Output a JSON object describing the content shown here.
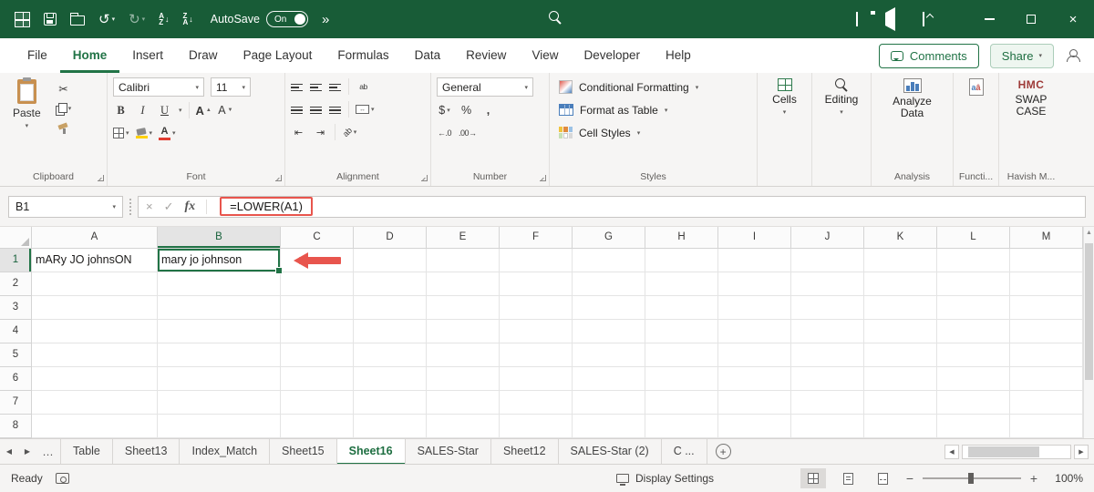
{
  "colors": {
    "accent": "#217346",
    "titlebar": "#185c37",
    "annotation": "#e8554d"
  },
  "titlebar": {
    "autosave_label": "AutoSave",
    "autosave_state": "On"
  },
  "icons": {
    "dropdown": "▾",
    "more": "»",
    "undo": "↺",
    "redo": "↻",
    "sort_a": "A",
    "sort_z": "Z",
    "sort_arrow": "↓",
    "cut": "✂",
    "bold": "B",
    "italic": "I",
    "underline": "U",
    "letter_a": "A",
    "tri_up": "▲",
    "tri_down": "▼",
    "merge_arrows": "↔",
    "wrap_text": "ab",
    "orient_text": "ab",
    "indent_left": "⇤",
    "indent_right": "⇥",
    "dollar": "$",
    "percent": "%",
    "comma": ",",
    "inc_decimal": "←.0",
    "dec_decimal": ".00→",
    "cancel": "×",
    "enter": "✓",
    "fx": "fx",
    "prev": "◀",
    "next": "▶",
    "up": "▲",
    "ellipsis": "…",
    "plus": "+",
    "zoom_out": "−",
    "zoom_in": "+",
    "close": "×"
  },
  "menu": {
    "tabs": [
      "File",
      "Home",
      "Insert",
      "Draw",
      "Page Layout",
      "Formulas",
      "Data",
      "Review",
      "View",
      "Developer",
      "Help"
    ],
    "active_tab": "Home",
    "comments_label": "Comments",
    "share_label": "Share"
  },
  "ribbon": {
    "clipboard": {
      "label": "Clipboard",
      "paste": "Paste"
    },
    "font": {
      "label": "Font",
      "family": "Calibri",
      "size": "11"
    },
    "alignment": {
      "label": "Alignment"
    },
    "number": {
      "label": "Number",
      "format": "General"
    },
    "styles": {
      "label": "Styles",
      "items": [
        "Conditional Formatting",
        "Format as Table",
        "Cell Styles"
      ]
    },
    "cells": {
      "label": "Cells"
    },
    "editing": {
      "label": "Editing"
    },
    "analysis": {
      "label": "Analysis",
      "button": "Analyze Data"
    },
    "functions_group": {
      "label": "Functi...",
      "icon_letters_1": "a",
      "icon_letters_2": "â"
    },
    "custom_group": {
      "label": "Havish M...",
      "logo": "HMC",
      "button": "SWAP CASE"
    }
  },
  "formula_bar": {
    "name_box": "B1",
    "formula": "=LOWER(A1)"
  },
  "grid": {
    "columns": [
      "A",
      "B",
      "C",
      "D",
      "E",
      "F",
      "G",
      "H",
      "I",
      "J",
      "K",
      "L",
      "M"
    ],
    "rows": [
      "1",
      "2",
      "3",
      "4",
      "5",
      "6",
      "7",
      "8"
    ],
    "cells": {
      "A1": "mARy JO johnsON",
      "B1": "mary jo johnson"
    },
    "selected_cell": "B1",
    "selected_column": "B",
    "selected_row": "1"
  },
  "sheets": {
    "tabs": [
      "Table",
      "Sheet13",
      "Index_Match",
      "Sheet15",
      "Sheet16",
      "SALES-Star",
      "Sheet12",
      "SALES-Star (2)",
      "C ..."
    ],
    "active": "Sheet16"
  },
  "status_bar": {
    "mode": "Ready",
    "display_settings": "Display Settings",
    "zoom": "100%"
  }
}
